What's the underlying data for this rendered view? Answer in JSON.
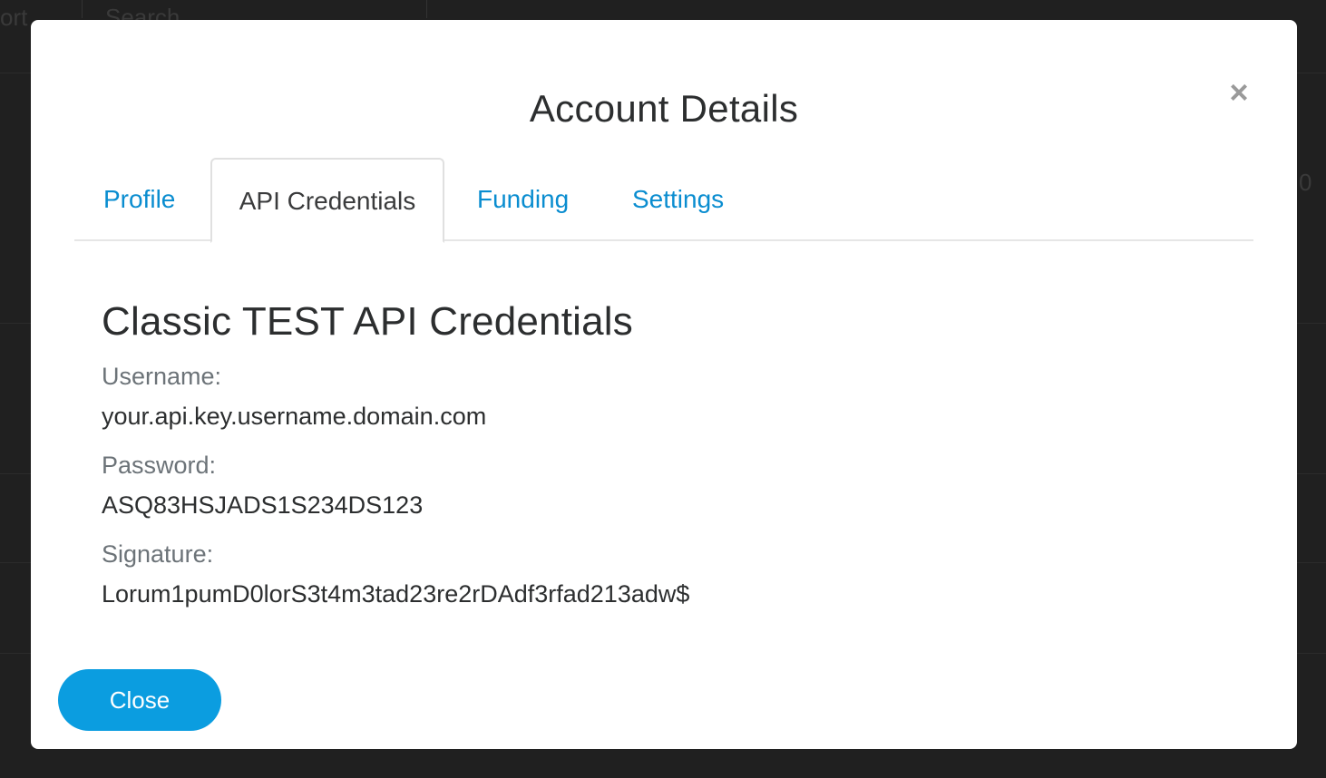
{
  "background": {
    "left_text": "ort",
    "search_text": "Search",
    "right_text": "0"
  },
  "modal": {
    "title": "Account Details",
    "close_glyph": "×",
    "tabs": [
      {
        "label": "Profile",
        "active": false
      },
      {
        "label": "API Credentials",
        "active": true
      },
      {
        "label": "Funding",
        "active": false
      },
      {
        "label": "Settings",
        "active": false
      }
    ],
    "section_title": "Classic TEST API Credentials",
    "fields": [
      {
        "label": "Username:",
        "value": "your.api.key.username.domain.com"
      },
      {
        "label": "Password:",
        "value": "ASQ83HSJADS1S234DS123"
      },
      {
        "label": "Signature:",
        "value": "Lorum1pumD0lorS3t4m3tad23re2rDAdf3rfad213adw$"
      }
    ],
    "close_button_label": "Close"
  },
  "colors": {
    "accent": "#0b9de0",
    "tab_link": "#0a8dd0",
    "backdrop": "#202020"
  }
}
